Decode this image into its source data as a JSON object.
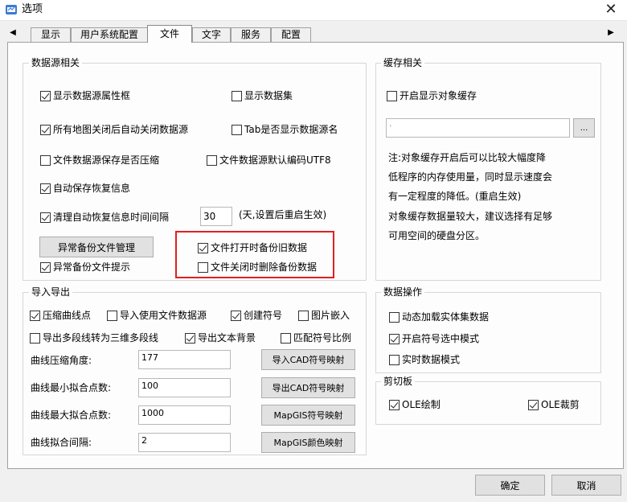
{
  "window": {
    "title": "选项",
    "close_glyph": "✕"
  },
  "tabs": {
    "left_arrow": "◀",
    "right_arrow": "▶",
    "items": [
      {
        "label": "显示",
        "selected": false
      },
      {
        "label": "用户系统配置",
        "selected": false
      },
      {
        "label": "文件",
        "selected": true
      },
      {
        "label": "文字",
        "selected": false
      },
      {
        "label": "服务",
        "selected": false
      },
      {
        "label": "配置",
        "selected": false
      }
    ]
  },
  "datasource": {
    "title": "数据源相关",
    "show_props": {
      "label": "显示数据源属性框",
      "checked": true
    },
    "show_dataset": {
      "label": "显示数据集",
      "checked": false
    },
    "auto_close": {
      "label": "所有地图关闭后自动关闭数据源",
      "checked": true
    },
    "tab_show_name": {
      "label": "Tab是否显示数据源名",
      "checked": false
    },
    "compress": {
      "label": "文件数据源保存是否压缩",
      "checked": false
    },
    "utf8": {
      "label": "文件数据源默认编码UTF8",
      "checked": false
    },
    "autosave": {
      "label": "自动保存恢复信息",
      "checked": true
    },
    "clear_interval": {
      "label": "清理自动恢复信息时间间隔",
      "checked": true
    },
    "interval_value": "30",
    "interval_hint": "(天,设置后重启生效)",
    "backup_manage_btn": "异常备份文件管理",
    "backup_prompt": {
      "label": "异常备份文件提示",
      "checked": true
    },
    "backup_on_open": {
      "label": "文件打开时备份旧数据",
      "checked": true
    },
    "delete_on_close": {
      "label": "文件关闭时删除备份数据",
      "checked": false
    }
  },
  "cache": {
    "title": "缓存相关",
    "enable": {
      "label": "开启显示对象缓存",
      "checked": false
    },
    "path_value": "·",
    "browse_btn": "...",
    "note": [
      "注:对象缓存开启后可以比较大幅度降",
      "低程序的内存使用量，同时显示速度会",
      "有一定程度的降低。(重启生效)",
      "对象缓存数据量较大，建议选择有足够",
      "可用空间的硬盘分区。"
    ]
  },
  "import_export": {
    "title": "导入导出",
    "compress_curve": {
      "label": "压缩曲线点",
      "checked": true
    },
    "use_file_ds": {
      "label": "导入使用文件数据源",
      "checked": false
    },
    "create_symbol": {
      "label": "创建符号",
      "checked": true
    },
    "embed_image": {
      "label": "图片嵌入",
      "checked": false
    },
    "polyline_3d": {
      "label": "导出多段线转为三维多段线",
      "checked": false
    },
    "export_text_bg": {
      "label": "导出文本背景",
      "checked": true
    },
    "match_symbol_scale": {
      "label": "匹配符号比例",
      "checked": false
    },
    "fields": [
      {
        "label": "曲线压缩角度:",
        "value": "177",
        "button": "导入CAD符号映射"
      },
      {
        "label": "曲线最小拟合点数:",
        "value": "100",
        "button": "导出CAD符号映射"
      },
      {
        "label": "曲线最大拟合点数:",
        "value": "1000",
        "button": "MapGIS符号映射"
      },
      {
        "label": "曲线拟合间隔:",
        "value": "2",
        "button": "MapGIS颜色映射"
      }
    ]
  },
  "data_ops": {
    "title": "数据操作",
    "dynamic_load": {
      "label": "动态加载实体集数据",
      "checked": false
    },
    "symbol_select": {
      "label": "开启符号选中模式",
      "checked": true
    },
    "realtime": {
      "label": "实时数据模式",
      "checked": false
    }
  },
  "clipboard": {
    "title": "剪切板",
    "ole_draw": {
      "label": "OLE绘制",
      "checked": true
    },
    "ole_crop": {
      "label": "OLE裁剪",
      "checked": true
    }
  },
  "footer": {
    "ok": "确定",
    "cancel": "取消"
  }
}
